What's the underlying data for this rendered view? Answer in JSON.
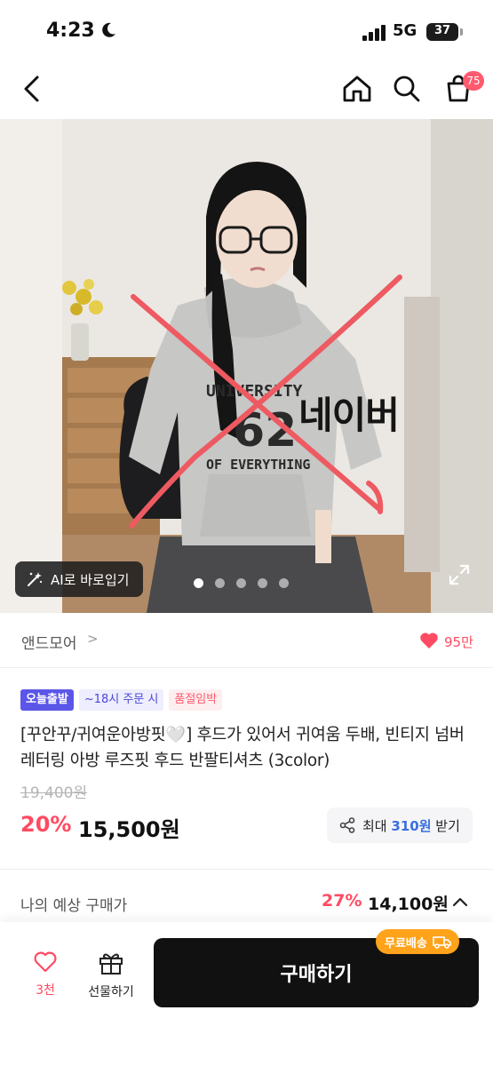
{
  "status_bar": {
    "time": "4:23",
    "network": "5G",
    "battery": "37"
  },
  "nav": {
    "cart_count": "75"
  },
  "hero": {
    "overlay_text": "네이버",
    "ai_button_label": "AI로 바로입기",
    "slide_count": 5,
    "active_slide": 0,
    "shirt_text_line1": "UNIVERSITY",
    "shirt_text_line2": "62",
    "shirt_text_line3": "OF EVERYTHING"
  },
  "brand": {
    "name": "앤드모어",
    "likes": "95만"
  },
  "product": {
    "badges": [
      "오늘출발",
      "~18시 주문 시",
      "품절임박"
    ],
    "title": "[꾸안꾸/귀여운아방핏🤍] 후드가 있어서 귀여움 두배, 빈티지 넘버 레터링 아방 루즈핏 후드 반팔티셔츠 (3color)",
    "original_price": "19,400원",
    "discount_rate": "20%",
    "price": "15,500원",
    "share": {
      "prefix": "최대",
      "points": "310원",
      "suffix": "받기"
    }
  },
  "expected": {
    "label": "나의 예상 구매가",
    "discount_rate": "27%",
    "price": "14,100원"
  },
  "bottom_bar": {
    "like_count": "3천",
    "gift_label": "선물하기",
    "buy_label": "구매하기",
    "free_shipping": "무료배송"
  },
  "colors": {
    "accent": "#ff4b63",
    "brand_purple": "#5b56e8",
    "shipping_orange": "#ffa31a",
    "buy_button": "#111111"
  }
}
